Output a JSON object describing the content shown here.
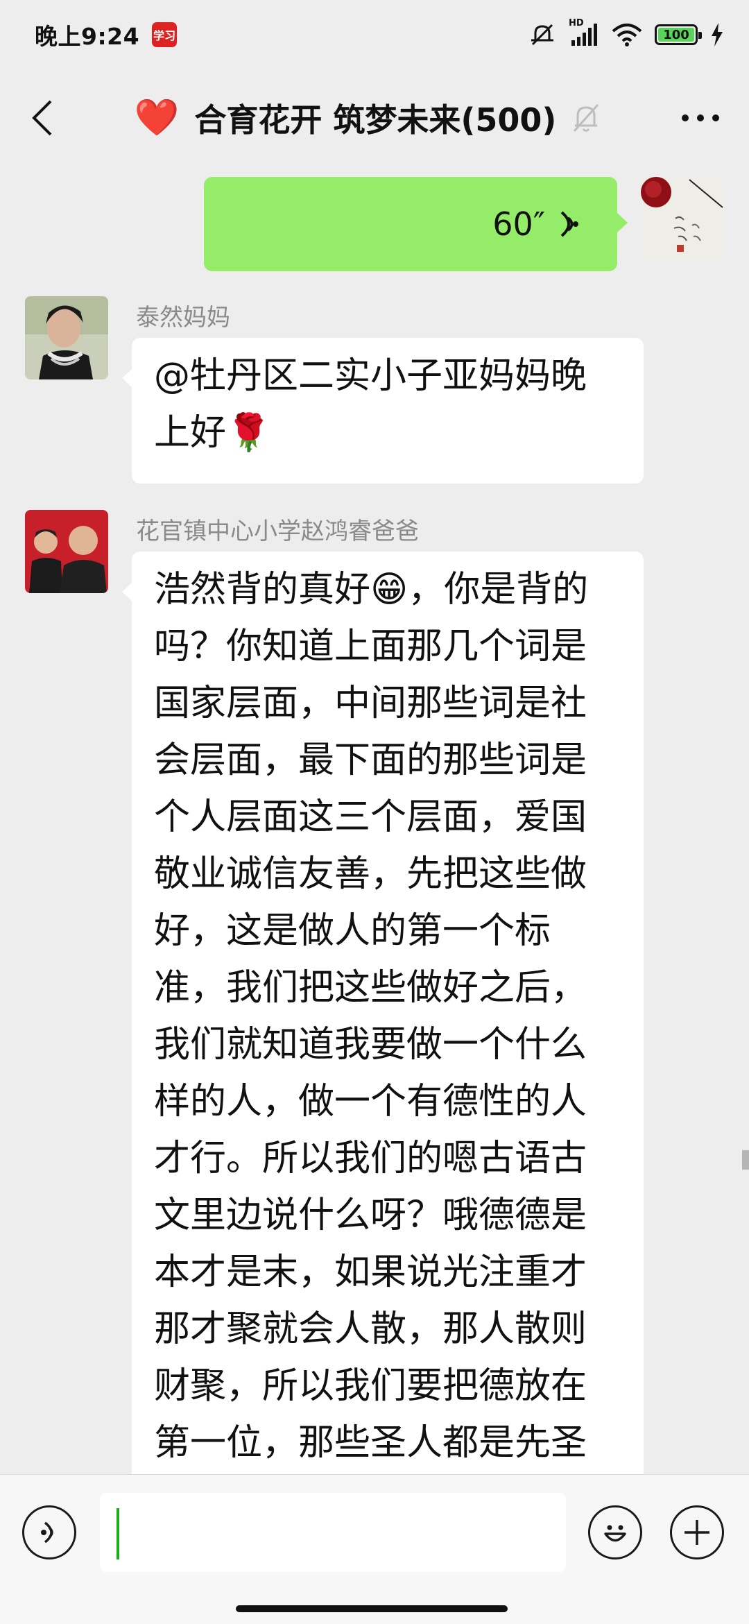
{
  "status_bar": {
    "time": "晚上9:24",
    "app_badge": "学习",
    "network_label": "HD",
    "battery": "100"
  },
  "header": {
    "title": "合育花开 筑梦未来(500)",
    "title_emoji": "❤️"
  },
  "messages": [
    {
      "type": "voice",
      "outgoing": true,
      "duration": "60″"
    },
    {
      "type": "text",
      "sender": "泰然妈妈",
      "text": "@牡丹区二实小子亚妈妈晚上好🌹"
    },
    {
      "type": "text",
      "sender": "花官镇中心小学赵鸿睿爸爸",
      "text": "浩然背的真好😁，你是背的吗？你知道上面那几个词是国家层面，中间那些词是社会层面，最下面的那些词是个人层面这三个层面，爱国敬业诚信友善，先把这些做好，这是做人的第一个标准，我们把这些做好之后，我们就知道我要做一个什么样的人，做一个有德性的人才行。所以我们的嗯古语古文里边说什么呀？哦德德是本才是末，如果说光注重才那才聚就会人散，那人散则财聚，所以我们要把德放在第一位，那些圣人都是先圣乎德"
    }
  ],
  "colors": {
    "background": "#EDEDED",
    "outgoing_bubble": "#95EC69",
    "incoming_bubble": "#FFFFFF",
    "caret": "#1AAD19"
  },
  "icons": [
    "back-arrow-icon",
    "heart-icon",
    "mute-bell-icon",
    "more-icon",
    "voice-wave-icon",
    "voice-input-icon",
    "emoji-icon",
    "plus-icon"
  ]
}
